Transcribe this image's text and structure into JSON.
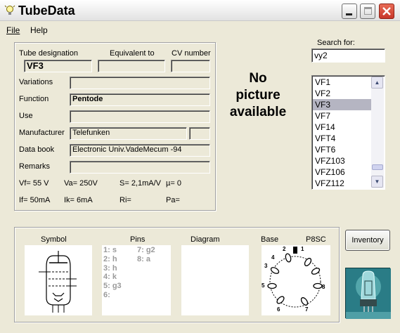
{
  "window": {
    "title": "TubeData"
  },
  "menu": {
    "file": "File",
    "help": "Help"
  },
  "search": {
    "label": "Search for:",
    "value": "vy2"
  },
  "tube": {
    "designation_label": "Tube designation",
    "designation": "VF3",
    "equivalent_label": "Equivalent to",
    "equivalent": "",
    "cv_label": "CV number",
    "cv": "",
    "variations_label": "Variations",
    "variations": "",
    "function_label": "Function",
    "function": "Pentode",
    "use_label": "Use",
    "use": "",
    "manufacturer_label": "Manufacturer",
    "manufacturer": "Telefunken",
    "databook_label": "Data book",
    "databook": "Electronic Univ.VadeMecum -94",
    "remarks_label": "Remarks",
    "remarks": ""
  },
  "params": {
    "vf": "Vf= 55 V",
    "va": "Va=  250V",
    "s": "S= 2,1mA/V",
    "mu": "µ=    0",
    "if": "If= 50mA",
    "ik": "Ik=   6mA",
    "ri": "Ri=",
    "pa": "Pa="
  },
  "picture": {
    "line1": "No",
    "line2": "picture",
    "line3": "available"
  },
  "tube_list": {
    "items": [
      "VF1",
      "VF2",
      "VF3",
      "VF7",
      "VF14",
      "VFT4",
      "VFT6",
      "VFZ103",
      "VFZ106",
      "VFZ112"
    ],
    "selected": "VF3"
  },
  "bottom": {
    "symbol_label": "Symbol",
    "pins_label": "Pins",
    "diagram_label": "Diagram",
    "base_label": "Base",
    "base_code": "P8SC",
    "pins_col1": [
      "1: s",
      "2: h",
      "3: h",
      "4: k",
      "5: g3",
      "6:"
    ],
    "pins_col2": [
      "7: g2",
      "8: a"
    ],
    "base_pin_numbers": [
      "1",
      "2",
      "3",
      "4",
      "5",
      "6",
      "7",
      "8"
    ]
  },
  "buttons": {
    "inventory": "Inventory"
  },
  "icons": [
    "lightbulb-icon",
    "minimize-icon",
    "maximize-icon",
    "close-icon",
    "scroll-up-icon",
    "scroll-down-icon",
    "tube-logo-icon"
  ]
}
